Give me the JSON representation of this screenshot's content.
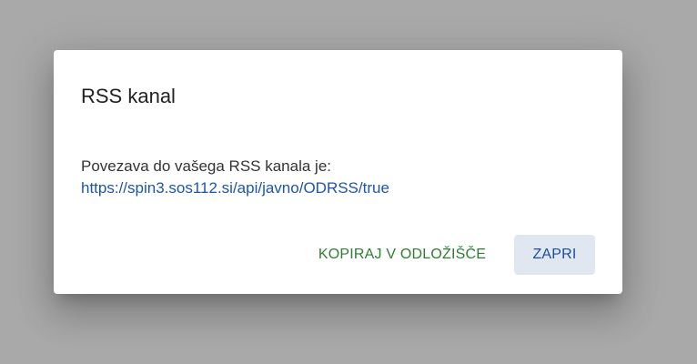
{
  "dialog": {
    "title": "RSS kanal",
    "text": "Povezava do vašega RSS kanala je:",
    "link": "https://spin3.sos112.si/api/javno/ODRSS/true",
    "copy_button": "KOPIRAJ V ODLOŽIŠČE",
    "close_button": "ZAPRI"
  },
  "colors": {
    "backdrop": "#a9a9a9",
    "dialog_bg": "#ffffff",
    "link": "#1e55a8",
    "copy_button_text": "#2e7d32",
    "close_button_text": "#1a4fa0",
    "close_button_bg": "#e1e7f1"
  }
}
